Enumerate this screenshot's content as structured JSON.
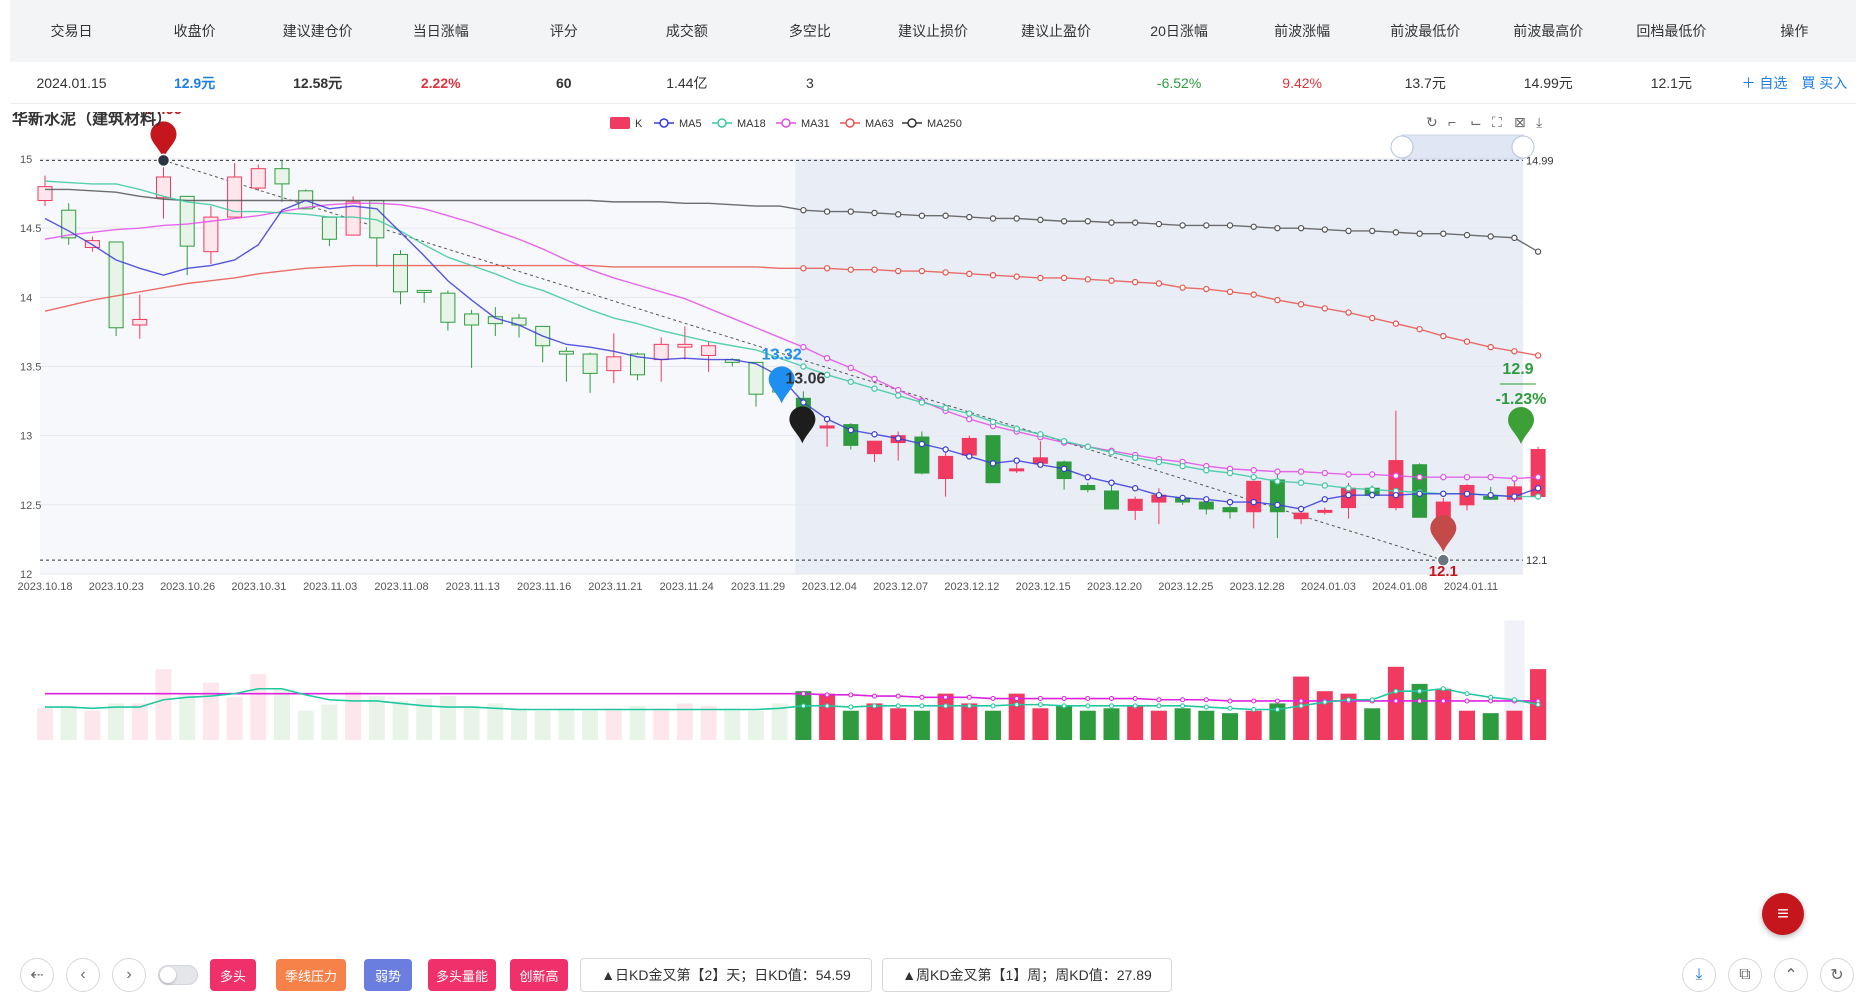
{
  "table": {
    "headers": [
      "交易日",
      "收盘价",
      "建议建仓价",
      "当日涨幅",
      "评分",
      "成交额",
      "多空比",
      "建议止损价",
      "建议止盈价",
      "20日涨幅",
      "前波涨幅",
      "前波最低价",
      "前波最高价",
      "回档最低价",
      "操作"
    ],
    "row": {
      "date": "2024.01.15",
      "close": "12.9元",
      "build_price": "12.58元",
      "day_change": "2.22%",
      "score": "60",
      "turnover": "1.44亿",
      "ratio": "3",
      "stop_loss": "",
      "take_profit": "",
      "change_20d": "-6.52%",
      "prev_wave_change": "9.42%",
      "prev_wave_low": "13.7元",
      "prev_wave_high": "14.99元",
      "pullback_low": "12.1元"
    },
    "ops": {
      "add": "＋ 自选",
      "buy": "買 买入"
    }
  },
  "colors": {
    "up": "#f03a5f",
    "down": "#2e9b3f",
    "ma5": "#3a3ad8",
    "ma18": "#3cc8a0",
    "ma31": "#e34ee8",
    "ma63": "#e8554e",
    "ma250": "#333333",
    "blue": "#1e7ee6"
  },
  "chart_data": {
    "type": "candlestick",
    "title": "华新水泥（建筑材料）",
    "legend": [
      "K",
      "MA5",
      "MA18",
      "MA31",
      "MA63",
      "MA250"
    ],
    "y_ticks": [
      "15",
      "14.5",
      "14",
      "13.5",
      "13",
      "12.5",
      "12"
    ],
    "ylim": [
      12,
      15
    ],
    "x_ticks": [
      "2023.10.18",
      "2023.10.23",
      "2023.10.26",
      "2023.10.31",
      "2023.11.03",
      "2023.11.08",
      "2023.11.13",
      "2023.11.16",
      "2023.11.21",
      "2023.11.24",
      "2023.11.29",
      "2023.12.04",
      "2023.12.07",
      "2023.12.12",
      "2023.12.15",
      "2023.12.20",
      "2023.12.25",
      "2023.12.28",
      "2024.01.03",
      "2024.01.08",
      "2024.01.11"
    ],
    "candles": [
      [
        14.7,
        14.8,
        14.88,
        14.66
      ],
      [
        14.63,
        14.43,
        14.68,
        14.38
      ],
      [
        14.36,
        14.41,
        14.44,
        14.33
      ],
      [
        14.4,
        13.78,
        14.4,
        13.72
      ],
      [
        13.8,
        13.84,
        14.02,
        13.7
      ],
      [
        14.72,
        14.87,
        14.94,
        14.57
      ],
      [
        14.73,
        14.37,
        14.72,
        14.16
      ],
      [
        14.33,
        14.58,
        14.66,
        14.24
      ],
      [
        14.58,
        14.87,
        14.97,
        14.58
      ],
      [
        14.79,
        14.93,
        14.96,
        14.77
      ],
      [
        14.93,
        14.82,
        14.99,
        14.69
      ],
      [
        14.77,
        14.64,
        14.78,
        14.64
      ],
      [
        14.58,
        14.42,
        14.58,
        14.37
      ],
      [
        14.45,
        14.69,
        14.73,
        14.45
      ],
      [
        14.7,
        14.43,
        14.69,
        14.22
      ],
      [
        14.31,
        14.04,
        14.34,
        13.95
      ],
      [
        14.05,
        14.04,
        14.05,
        13.96
      ],
      [
        14.03,
        13.82,
        14.05,
        13.76
      ],
      [
        13.88,
        13.8,
        13.91,
        13.49
      ],
      [
        13.86,
        13.81,
        13.93,
        13.72
      ],
      [
        13.85,
        13.8,
        13.88,
        13.71
      ],
      [
        13.79,
        13.65,
        13.79,
        13.53
      ],
      [
        13.61,
        13.59,
        13.64,
        13.39
      ],
      [
        13.59,
        13.45,
        13.6,
        13.31
      ],
      [
        13.47,
        13.57,
        13.74,
        13.38
      ],
      [
        13.59,
        13.44,
        13.6,
        13.4
      ],
      [
        13.55,
        13.66,
        13.71,
        13.39
      ],
      [
        13.64,
        13.66,
        13.79,
        13.55
      ],
      [
        13.58,
        13.65,
        13.68,
        13.46
      ],
      [
        13.55,
        13.53,
        13.56,
        13.5
      ],
      [
        13.53,
        13.3,
        13.53,
        13.21
      ],
      [
        13.33,
        13.32,
        13.38,
        13.3
      ],
      [
        13.27,
        13.06,
        13.32,
        13.06
      ],
      [
        13.07,
        13.07,
        13.1,
        12.92
      ],
      [
        13.08,
        12.93,
        13.09,
        12.9
      ],
      [
        12.87,
        12.96,
        12.96,
        12.81
      ],
      [
        12.95,
        13.0,
        13.03,
        12.82
      ],
      [
        12.99,
        12.73,
        13.03,
        12.72
      ],
      [
        12.69,
        12.85,
        12.92,
        12.56
      ],
      [
        12.86,
        12.98,
        13.0,
        12.85
      ],
      [
        13.0,
        12.66,
        13.0,
        12.66
      ],
      [
        12.75,
        12.76,
        12.8,
        12.73
      ],
      [
        12.8,
        12.84,
        12.96,
        12.78
      ],
      [
        12.81,
        12.69,
        12.82,
        12.61
      ],
      [
        12.64,
        12.61,
        12.66,
        12.59
      ],
      [
        12.6,
        12.47,
        12.64,
        12.48
      ],
      [
        12.46,
        12.54,
        12.56,
        12.39
      ],
      [
        12.52,
        12.57,
        12.62,
        12.36
      ],
      [
        12.55,
        12.52,
        12.55,
        12.5
      ],
      [
        12.52,
        12.47,
        12.56,
        12.43
      ],
      [
        12.48,
        12.45,
        12.52,
        12.4
      ],
      [
        12.45,
        12.67,
        12.67,
        12.33
      ],
      [
        12.68,
        12.45,
        12.72,
        12.26
      ],
      [
        12.4,
        12.44,
        12.46,
        12.36
      ],
      [
        12.45,
        12.46,
        12.48,
        12.43
      ],
      [
        12.48,
        12.62,
        12.66,
        12.4
      ],
      [
        12.62,
        12.57,
        12.64,
        12.56
      ],
      [
        12.48,
        12.82,
        13.18,
        12.46
      ],
      [
        12.79,
        12.41,
        12.8,
        12.41
      ],
      [
        12.37,
        12.52,
        12.55,
        12.34
      ],
      [
        12.5,
        12.64,
        12.65,
        12.46
      ],
      [
        12.56,
        12.54,
        12.63,
        12.56
      ],
      [
        12.54,
        12.63,
        12.69,
        12.52
      ],
      [
        12.56,
        12.9,
        12.92,
        12.55
      ]
    ],
    "ma5": [
      14.57,
      14.48,
      14.38,
      14.27,
      14.21,
      14.16,
      14.21,
      14.23,
      14.27,
      14.38,
      14.63,
      14.7,
      14.64,
      14.66,
      14.64,
      14.47,
      14.3,
      14.12,
      13.98,
      13.85,
      13.8,
      13.72,
      13.66,
      13.64,
      13.61,
      13.57,
      13.55,
      13.56,
      13.55,
      13.55,
      13.52,
      13.43,
      13.24,
      13.12,
      13.04,
      13.01,
      12.98,
      12.94,
      12.9,
      12.85,
      12.8,
      12.82,
      12.79,
      12.76,
      12.7,
      12.66,
      12.62,
      12.57,
      12.55,
      12.54,
      12.52,
      12.52,
      12.5,
      12.47,
      12.54,
      12.57,
      12.57,
      12.57,
      12.58,
      12.58,
      12.58,
      12.57,
      12.56,
      12.62
    ],
    "ma18": [
      14.84,
      14.83,
      14.82,
      14.82,
      14.78,
      14.73,
      14.69,
      14.67,
      14.62,
      14.62,
      14.61,
      14.6,
      14.58,
      14.58,
      14.56,
      14.48,
      14.38,
      14.29,
      14.23,
      14.17,
      14.1,
      14.05,
      13.98,
      13.91,
      13.85,
      13.81,
      13.76,
      13.72,
      13.68,
      13.65,
      13.62,
      13.56,
      13.5,
      13.44,
      13.39,
      13.34,
      13.29,
      13.24,
      13.2,
      13.16,
      13.1,
      13.05,
      13.01,
      12.96,
      12.92,
      12.88,
      12.84,
      12.81,
      12.78,
      12.75,
      12.73,
      12.7,
      12.67,
      12.66,
      12.64,
      12.62,
      12.61,
      12.6,
      12.59,
      12.58,
      12.58,
      12.57,
      12.56,
      12.56
    ],
    "ma31": [
      14.42,
      14.45,
      14.47,
      14.49,
      14.5,
      14.52,
      14.53,
      14.55,
      14.57,
      14.59,
      14.62,
      14.65,
      14.67,
      14.68,
      14.68,
      14.67,
      14.64,
      14.59,
      14.54,
      14.48,
      14.42,
      14.35,
      14.27,
      14.2,
      14.14,
      14.09,
      14.04,
      13.99,
      13.92,
      13.85,
      13.78,
      13.71,
      13.64,
      13.56,
      13.49,
      13.41,
      13.33,
      13.25,
      13.18,
      13.12,
      13.07,
      13.03,
      12.99,
      12.95,
      12.92,
      12.89,
      12.86,
      12.83,
      12.81,
      12.78,
      12.76,
      12.75,
      12.74,
      12.74,
      12.73,
      12.72,
      12.72,
      12.71,
      12.7,
      12.7,
      12.7,
      12.7,
      12.69,
      12.7
    ],
    "ma63": [
      13.9,
      13.94,
      13.98,
      14.01,
      14.04,
      14.07,
      14.1,
      14.12,
      14.14,
      14.17,
      14.19,
      14.21,
      14.22,
      14.23,
      14.23,
      14.23,
      14.23,
      14.23,
      14.23,
      14.23,
      14.23,
      14.23,
      14.23,
      14.23,
      14.22,
      14.22,
      14.22,
      14.22,
      14.22,
      14.22,
      14.22,
      14.21,
      14.21,
      14.21,
      14.2,
      14.2,
      14.19,
      14.19,
      14.18,
      14.17,
      14.16,
      14.15,
      14.14,
      14.14,
      14.13,
      14.12,
      14.11,
      14.1,
      14.07,
      14.06,
      14.04,
      14.02,
      13.98,
      13.95,
      13.92,
      13.89,
      13.85,
      13.81,
      13.77,
      13.72,
      13.68,
      13.64,
      13.61,
      13.58
    ],
    "ma250": [
      14.78,
      14.78,
      14.77,
      14.76,
      14.73,
      14.71,
      14.7,
      14.7,
      14.7,
      14.7,
      14.7,
      14.7,
      14.7,
      14.7,
      14.7,
      14.7,
      14.7,
      14.7,
      14.7,
      14.7,
      14.7,
      14.7,
      14.7,
      14.7,
      14.69,
      14.69,
      14.69,
      14.68,
      14.68,
      14.67,
      14.66,
      14.66,
      14.63,
      14.62,
      14.62,
      14.61,
      14.6,
      14.59,
      14.59,
      14.58,
      14.57,
      14.57,
      14.56,
      14.55,
      14.55,
      14.54,
      14.54,
      14.53,
      14.52,
      14.52,
      14.52,
      14.51,
      14.5,
      14.5,
      14.49,
      14.48,
      14.48,
      14.47,
      14.46,
      14.46,
      14.45,
      14.44,
      14.43,
      14.33
    ],
    "volumes": [
      26,
      28,
      24,
      30,
      30,
      58,
      38,
      47,
      35,
      54,
      42,
      24,
      29,
      40,
      36,
      32,
      34,
      36,
      28,
      30,
      26,
      24,
      26,
      24,
      26,
      28,
      26,
      30,
      28,
      26,
      24,
      30,
      40,
      38,
      24,
      30,
      26,
      24,
      38,
      30,
      24,
      38,
      26,
      28,
      24,
      26,
      28,
      24,
      26,
      24,
      22,
      24,
      30,
      52,
      40,
      38,
      26,
      60,
      46,
      42,
      24,
      22,
      24,
      58
    ],
    "vol_ma_a": [
      27,
      27,
      26,
      27,
      27,
      33,
      35,
      36,
      38,
      42,
      42,
      37,
      33,
      32,
      32,
      30,
      28,
      27,
      27,
      26,
      25,
      25,
      25,
      25,
      25,
      25,
      25,
      25,
      25,
      25,
      25,
      26,
      28,
      28,
      27,
      28,
      28,
      28,
      28,
      28,
      28,
      29,
      29,
      28,
      28,
      28,
      28,
      28,
      28,
      27,
      26,
      25,
      25,
      28,
      31,
      33,
      33,
      40,
      40,
      42,
      38,
      35,
      33,
      29
    ],
    "vol_ma_b": [
      38,
      38,
      38,
      38,
      38,
      38,
      38,
      38,
      38,
      38,
      38,
      38,
      38,
      38,
      38,
      38,
      38,
      38,
      38,
      38,
      38,
      38,
      38,
      38,
      38,
      38,
      38,
      38,
      38,
      38,
      38,
      38,
      38,
      37,
      37,
      36,
      36,
      35,
      35,
      35,
      34,
      34,
      34,
      34,
      34,
      34,
      34,
      33,
      33,
      33,
      32,
      32,
      32,
      32,
      32,
      32,
      32,
      32,
      32,
      32,
      32,
      32,
      32,
      32
    ],
    "markers": {
      "high_label": "14.99",
      "low_label": "12.1",
      "mid_label": "13.32",
      "dark_label": "13.06",
      "last_close": "12.9",
      "last_change": "-1.23%"
    },
    "ref_lines": {
      "top": "14.99",
      "bottom": "12.1"
    }
  },
  "toolbar": {
    "prev_icon": "arrow-left-icon",
    "back_icon": "chevron-left-icon",
    "forward_icon": "chevron-right-icon",
    "tags": [
      "多头",
      "季线压力",
      "弱势",
      "多头量能",
      "创新高"
    ],
    "signal_day": "▲日KD金叉第【2】天；日KD值：54.59",
    "signal_week": "▲周KD金叉第【1】周；周KD值：27.89"
  }
}
